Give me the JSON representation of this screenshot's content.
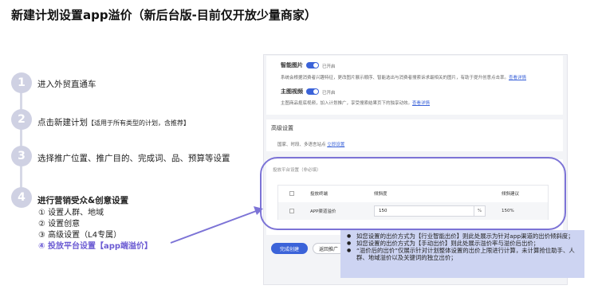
{
  "title": "新建计划设置app溢价（新后台版-目前仅开放少量商家）",
  "steps": [
    {
      "num": "1",
      "text": "进入外贸直通车",
      "note": ""
    },
    {
      "num": "2",
      "text": "点击新建计划",
      "note": "【适用于所有类型的计划，含推荐】"
    },
    {
      "num": "3",
      "text": "选择推广位置、推广目的、完成词、品、预算等设置",
      "note": ""
    },
    {
      "num": "4",
      "text": "进行营销受众&创意设置",
      "note": ""
    }
  ],
  "substeps": [
    "① 设置人群、地域",
    "② 设置创意",
    "③ 高级设置（L4专属）",
    "④ 投放平台设置【app端溢价】"
  ],
  "panel": {
    "smart_img_label": "智能图片",
    "smart_img_status": "已开启",
    "smart_img_desc": "系统会根据消费者兴趣特征，更改图片展示顺序、智能选出与消费者搜索诉求最相关的图片，有助于提升创意点击率。",
    "smart_img_link": "查看详情",
    "main_video_label": "主图视频",
    "main_video_status": "已开启",
    "main_video_desc": "主图商品抠底视频，加入计划推广，享受搜索结果页下的独享动效。",
    "main_video_link": "查看详情",
    "advanced_title": "高级设置",
    "advanced_desc": "国家、时段、多语言站点",
    "advanced_link": "立即设置",
    "platform_title": "投放平台设置",
    "platform_optional": "（非必填）",
    "col_terminal": "投放终端",
    "col_slope": "倾斜度",
    "col_suggest": "倾斜建议",
    "row_terminal": "APP渠道溢价",
    "row_value": "150",
    "row_unit": "%",
    "row_suggest": "150%",
    "btn_done": "完成创建",
    "btn_back": "返回推广"
  },
  "notes": [
    "如您设置的出价方式为【行业智能出价】则此处展示为针对app渠道的出价倾斜度；",
    "如您设置的出价方式为【手动出价】则此处展示溢价率与溢价后出价；",
    "“溢价后的出价”仅展示针对计划整体设置的出价上限进行计算，未计算抢位助手、人群、地域溢价以及关键词的独立出价；"
  ],
  "colors": {
    "accent": "#3b63d9",
    "highlight": "#6b5bd3",
    "circle": "#cfd1e3",
    "note_bg": "#cdd4f2"
  }
}
